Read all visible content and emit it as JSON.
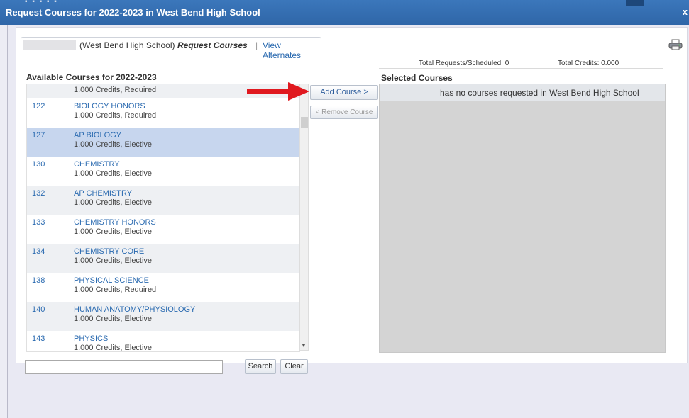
{
  "window": {
    "title": "Request Courses for 2022-2023 in West Bend High School",
    "close_label": "x",
    "dots": "▪ ▪ ▪ ▪ ▪"
  },
  "tabs": {
    "school_label": "(West Bend High School)",
    "active_tab": "Request Courses",
    "separator": "|",
    "alternates_tab": "View Alternates"
  },
  "totals": {
    "requests_scheduled": "Total Requests/Scheduled:  0",
    "total_credits": "Total Credits:  0.000"
  },
  "available": {
    "title": "Available Courses for 2022-2023",
    "partial_row_info": "1.000 Credits,  Required",
    "courses": [
      {
        "number": "122",
        "name": "BIOLOGY HONORS",
        "info": "1.000 Credits,  Required"
      },
      {
        "number": "127",
        "name": "AP BIOLOGY",
        "info": "1.000 Credits,  Elective"
      },
      {
        "number": "130",
        "name": "CHEMISTRY",
        "info": "1.000 Credits,  Elective"
      },
      {
        "number": "132",
        "name": "AP CHEMISTRY",
        "info": "1.000 Credits,  Elective"
      },
      {
        "number": "133",
        "name": "CHEMISTRY HONORS",
        "info": "1.000 Credits,  Elective"
      },
      {
        "number": "134",
        "name": "CHEMISTRY CORE",
        "info": "1.000 Credits,  Elective"
      },
      {
        "number": "138",
        "name": "PHYSICAL SCIENCE",
        "info": "1.000 Credits,  Required"
      },
      {
        "number": "140",
        "name": "HUMAN ANATOMY/PHYSIOLOGY",
        "info": "1.000 Credits,  Elective"
      },
      {
        "number": "143",
        "name": "PHYSICS",
        "info": "1.000 Credits,  Elective"
      }
    ]
  },
  "actions": {
    "add_label": "Add Course >",
    "remove_label": "< Remove Course"
  },
  "selected": {
    "title": "Selected Courses",
    "empty_message": "has no courses requested in West Bend High School"
  },
  "search": {
    "value": "",
    "search_label": "Search",
    "clear_label": "Clear"
  },
  "colors": {
    "title_bar": "#3070b3",
    "link": "#2a6ab0",
    "selected_row": "#c7d6ee",
    "arrow": "#e0191f"
  }
}
